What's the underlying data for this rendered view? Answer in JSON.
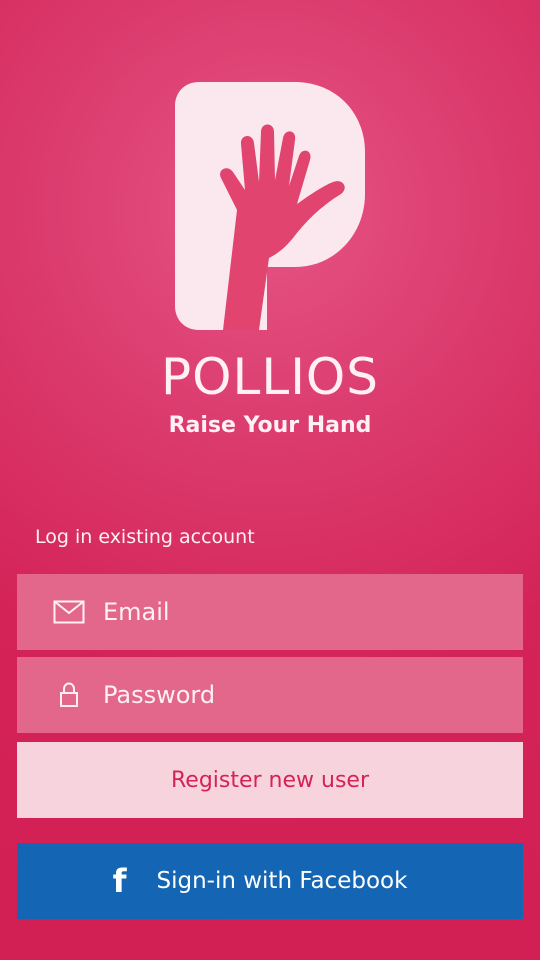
{
  "brand": {
    "name": "POLLIOS",
    "tagline": "Raise Your Hand",
    "logo_icon": "raised-hand-p-logo"
  },
  "login": {
    "section_label": "Log in existing account",
    "email": {
      "placeholder": "Email",
      "value": "",
      "icon": "envelope-icon"
    },
    "password": {
      "placeholder": "Password",
      "value": "",
      "icon": "lock-icon"
    }
  },
  "actions": {
    "register_label": "Register new user",
    "facebook_label": "Sign-in with Facebook",
    "facebook_icon": "facebook-f-icon"
  },
  "colors": {
    "background": "#d21f54",
    "field_bg": "#e2678a",
    "register_bg": "#f7d3dd",
    "register_text": "#d42357",
    "facebook_bg": "#1565b5"
  }
}
